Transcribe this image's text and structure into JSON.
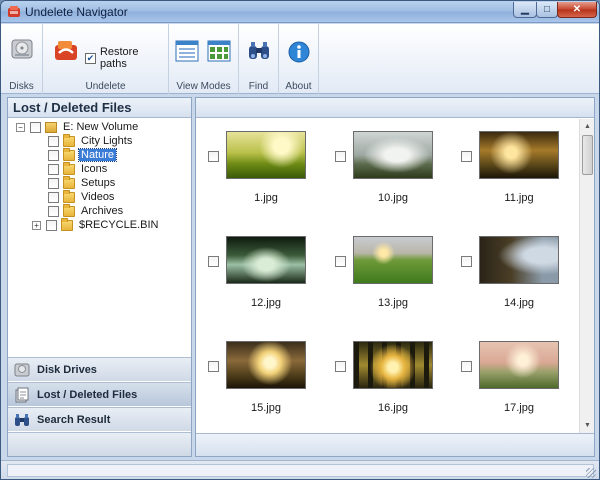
{
  "window": {
    "title": "Undelete Navigator",
    "accent": "#3a7bd5"
  },
  "ribbon": {
    "groups": [
      {
        "label": "Disks"
      },
      {
        "label": "Undelete",
        "restore_paths_label": "Restore paths",
        "restore_paths_checked": true
      },
      {
        "label": "View Modes"
      },
      {
        "label": "Find"
      },
      {
        "label": "About"
      }
    ]
  },
  "left_panel": {
    "header": "Lost / Deleted Files",
    "tree": {
      "root": "E: New Volume",
      "children": [
        "City Lights",
        "Nature",
        "Icons",
        "Setups",
        "Videos",
        "Archives"
      ],
      "selected": "Nature",
      "sibling": "$RECYCLE.BIN"
    },
    "nav": [
      {
        "label": "Disk Drives",
        "icon": "disk-drive-icon"
      },
      {
        "label": "Lost / Deleted Files",
        "icon": "deleted-files-icon",
        "active": true
      },
      {
        "label": "Search Result",
        "icon": "binoculars-icon"
      }
    ]
  },
  "files": [
    {
      "name": "1.jpg"
    },
    {
      "name": "10.jpg"
    },
    {
      "name": "11.jpg"
    },
    {
      "name": "12.jpg"
    },
    {
      "name": "13.jpg"
    },
    {
      "name": "14.jpg"
    },
    {
      "name": "15.jpg"
    },
    {
      "name": "16.jpg"
    },
    {
      "name": "17.jpg"
    }
  ]
}
